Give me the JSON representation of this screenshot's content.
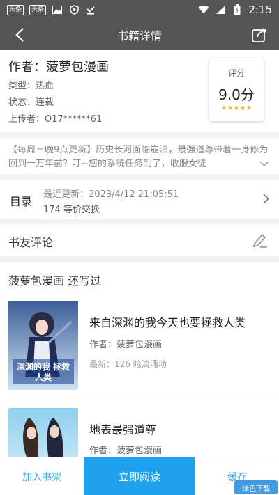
{
  "status_bar": {
    "badges": [
      "头条",
      "头条"
    ],
    "time": "2:15"
  },
  "header": {
    "title": "书籍详情"
  },
  "book": {
    "author": "作者：菠萝包漫画",
    "type": "类型：热血",
    "status": "状态：连载",
    "uploader": "上传者：O17******61",
    "rating_label": "评分",
    "rating_value": "9.0分",
    "stars": "★★★★★",
    "description": "【每周三晚9点更新】历史长河面临崩溃，最强道尊带着一身修为回到十万年前？叮~您的系统任务到了，收服女徒"
  },
  "catalog": {
    "label": "目录",
    "latest_update": "最近更新：2023/4/12 21:05:51",
    "chapters": "174 等价交换"
  },
  "comments": {
    "label": "书友评论"
  },
  "more_books": {
    "title": "菠萝包漫画  还写过",
    "items": [
      {
        "name": "来自深渊的我今天也要拯救人类",
        "author": "作者：菠萝包漫画",
        "latest": "最新：126 暗流涌动",
        "cover_text": "深渊的我 拯救人类"
      },
      {
        "name": "地表最强道尊",
        "author": "作者：菠萝包漫画",
        "latest": ""
      }
    ]
  },
  "bottom_bar": {
    "add_shelf": "加入书架",
    "read_now": "立即阅读",
    "cache": "缓存"
  },
  "watermark": "绿色下载"
}
